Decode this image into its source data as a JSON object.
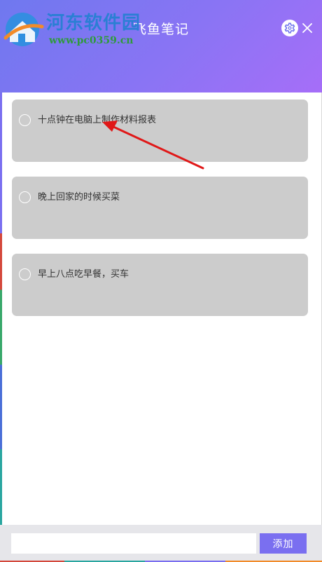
{
  "header": {
    "title": "飞鱼笔记",
    "settings_icon": "gear-icon",
    "close_icon": "close-icon",
    "gradient_start": "#6f78ef",
    "gradient_end": "#a66ef8"
  },
  "watermark": {
    "name": "河东软件园",
    "url": "www.pc0359.cn"
  },
  "notes": [
    {
      "text": "十点钟在电脑上制作材料报表",
      "done": false
    },
    {
      "text": "晚上回家的时候买菜",
      "done": false
    },
    {
      "text": "早上八点吃早餐，买车",
      "done": false
    }
  ],
  "footer": {
    "input_value": "",
    "input_placeholder": "",
    "add_label": "添加",
    "accent": "#7a6ff0"
  },
  "annotation": {
    "arrow_color": "#e01818"
  }
}
